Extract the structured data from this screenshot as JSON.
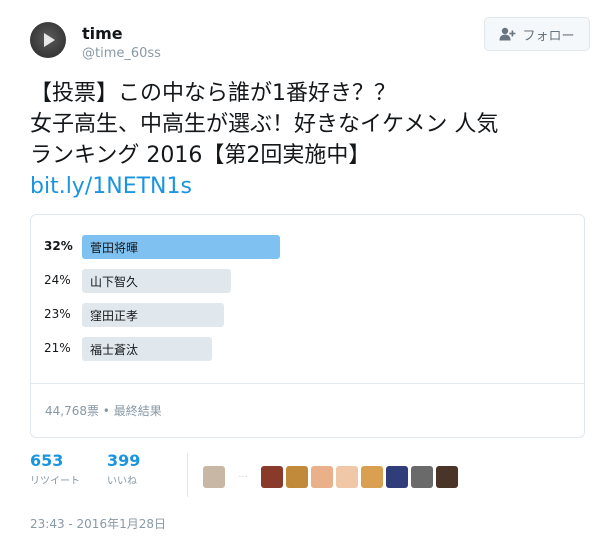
{
  "author": {
    "name": "time",
    "handle": "@time_60ss"
  },
  "follow_button": {
    "label": "フォロー"
  },
  "tweet": {
    "line1": "【投票】この中なら誰が1番好き？？",
    "line2": "女子高生、中高生が選ぶ！好きなイケメン 人気",
    "line3": "ランキング 2016【第2回実施中】",
    "link": "bit.ly/1NETN1s"
  },
  "poll": {
    "options": [
      {
        "percent_label": "32%",
        "label": "菅田将暉",
        "percent": 32,
        "winner": true
      },
      {
        "percent_label": "24%",
        "label": "山下智久",
        "percent": 24,
        "winner": false
      },
      {
        "percent_label": "23%",
        "label": "窪田正孝",
        "percent": 23,
        "winner": false
      },
      {
        "percent_label": "21%",
        "label": "福士蒼汰",
        "percent": 21,
        "winner": false
      }
    ],
    "footer": "44,768票 • 最終結果",
    "colors": {
      "winner": "#7fc1f0",
      "other": "#e1e8ed"
    }
  },
  "stats": {
    "retweets": {
      "count": "653",
      "caption": "リツイート"
    },
    "likes": {
      "count": "399",
      "caption": "いいね"
    }
  },
  "liker_avatars": [
    {
      "color": "#c9b7a6"
    },
    {
      "color": "#8a3a2a"
    },
    {
      "color": "#c08a3a"
    },
    {
      "color": "#e9b08a"
    },
    {
      "color": "#f0c8a8"
    },
    {
      "color": "#d8a050"
    },
    {
      "color": "#2f3d7a"
    },
    {
      "color": "#6a6a6a"
    },
    {
      "color": "#4a3428"
    }
  ],
  "timestamp": "23:43 - 2016年1月28日"
}
